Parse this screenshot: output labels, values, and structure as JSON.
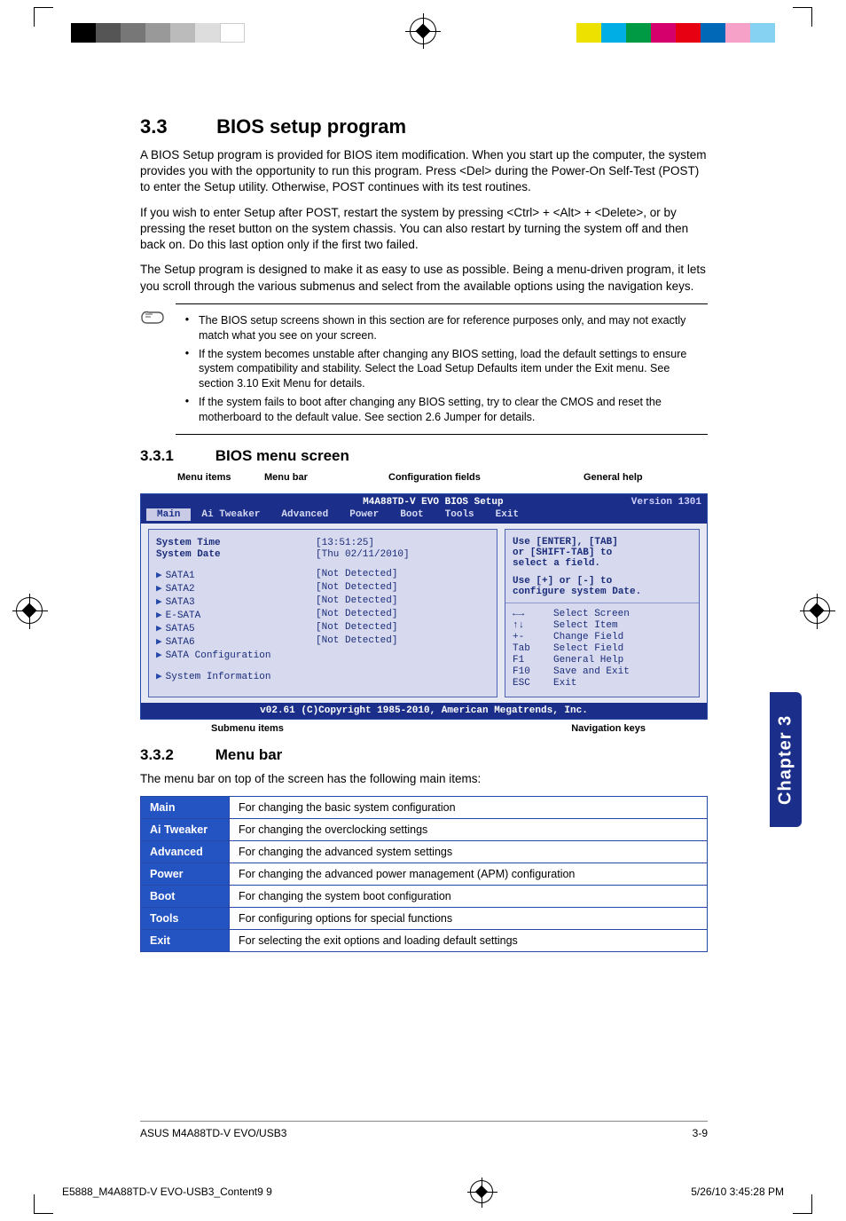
{
  "section": {
    "number": "3.3",
    "title": "BIOS setup program",
    "para1": "A BIOS Setup program is provided for BIOS item modification. When you start up the computer, the system provides you with the opportunity to run this program. Press <Del> during the Power-On Self-Test (POST) to enter the Setup utility. Otherwise, POST continues with its test routines.",
    "para2": "If you wish to enter Setup after POST, restart the system by pressing <Ctrl> + <Alt> + <Delete>, or by pressing the reset button on the system chassis. You can also restart by turning the system off and then back on. Do this last option only if the first two failed.",
    "para3": "The Setup program is designed to make it as easy to use as possible. Being a menu-driven program, it lets you scroll through the various submenus and select from the available options using the navigation keys."
  },
  "notes": [
    "The BIOS setup screens shown in this section are for reference purposes only, and may not exactly match what you see on your screen.",
    "If the system becomes unstable after changing any BIOS setting, load the default settings to ensure system compatibility and stability. Select the Load Setup Defaults item under the Exit menu. See section 3.10 Exit Menu for details.",
    "If the system fails to boot after changing any BIOS setting, try to clear the CMOS and reset the motherboard to the default value. See section 2.6 Jumper for details."
  ],
  "sub1": {
    "number": "3.3.1",
    "title": "BIOS menu screen"
  },
  "callouts": {
    "menu_items": "Menu items",
    "menu_bar": "Menu bar",
    "config_fields": "Configuration fields",
    "general_help": "General help",
    "submenu_items": "Submenu items",
    "nav_keys": "Navigation keys"
  },
  "bios": {
    "title_center": "M4A88TD-V EVO BIOS Setup",
    "version": "Version 1301",
    "tabs": [
      "Main",
      "Ai Tweaker",
      "Advanced",
      "Power",
      "Boot",
      "Tools",
      "Exit"
    ],
    "active_tab": "Main",
    "rows": [
      {
        "k": "System Time",
        "v": "[13:51:25]"
      },
      {
        "k": "System Date",
        "v": "[Thu 02/11/2010]"
      }
    ],
    "sata_rows": [
      {
        "k": "SATA1",
        "v": "[Not Detected]"
      },
      {
        "k": "SATA2",
        "v": "[Not Detected]"
      },
      {
        "k": "SATA3",
        "v": "[Not Detected]"
      },
      {
        "k": "E-SATA",
        "v": "[Not Detected]"
      },
      {
        "k": "SATA5",
        "v": "[Not Detected]"
      },
      {
        "k": "SATA6",
        "v": "[Not Detected]"
      }
    ],
    "extra_items": [
      "SATA Configuration",
      "System Information"
    ],
    "help_lines": [
      "Use [ENTER], [TAB]",
      "or [SHIFT-TAB] to",
      "select a field.",
      "",
      "Use [+] or [-] to",
      "configure system Date."
    ],
    "nav": [
      {
        "k": "←→",
        "t": "Select Screen"
      },
      {
        "k": "↑↓",
        "t": "Select Item"
      },
      {
        "k": "+-",
        "t": "Change Field"
      },
      {
        "k": "Tab",
        "t": "Select Field"
      },
      {
        "k": "F1",
        "t": "General Help"
      },
      {
        "k": "F10",
        "t": "Save and Exit"
      },
      {
        "k": "ESC",
        "t": "Exit"
      }
    ],
    "footer": "v02.61 (C)Copyright 1985-2010, American Megatrends, Inc."
  },
  "sub2": {
    "number": "3.3.2",
    "title": "Menu bar"
  },
  "menubar_intro": "The menu bar on top of the screen has the following main items:",
  "menubar_table": [
    {
      "name": "Main",
      "desc": "For changing the basic system configuration"
    },
    {
      "name": "Ai Tweaker",
      "desc": "For changing the overclocking settings"
    },
    {
      "name": "Advanced",
      "desc": "For changing the advanced system settings"
    },
    {
      "name": "Power",
      "desc": "For changing the advanced power management (APM) configuration"
    },
    {
      "name": "Boot",
      "desc": "For changing the system boot configuration"
    },
    {
      "name": "Tools",
      "desc": "For configuring options for special functions"
    },
    {
      "name": "Exit",
      "desc": "For selecting the exit options and loading default settings"
    }
  ],
  "footer": {
    "left": "ASUS M4A88TD-V EVO/USB3",
    "right": "3-9"
  },
  "chapter_tab": "Chapter 3",
  "print_footer": {
    "left": "E5888_M4A88TD-V EVO-USB3_Content9   9",
    "right": "5/26/10   3:45:28 PM"
  },
  "swatches_left": [
    "#000",
    "#666",
    "#888",
    "#aaa",
    "#ccc",
    "#eee",
    "#fff"
  ],
  "swatches_right": [
    "#e6d800",
    "#00b2e3",
    "#009e3d",
    "#d40072",
    "#e30613",
    "#f39200",
    "#ffde00",
    "#f5b5d2",
    "#a0d9ef"
  ]
}
